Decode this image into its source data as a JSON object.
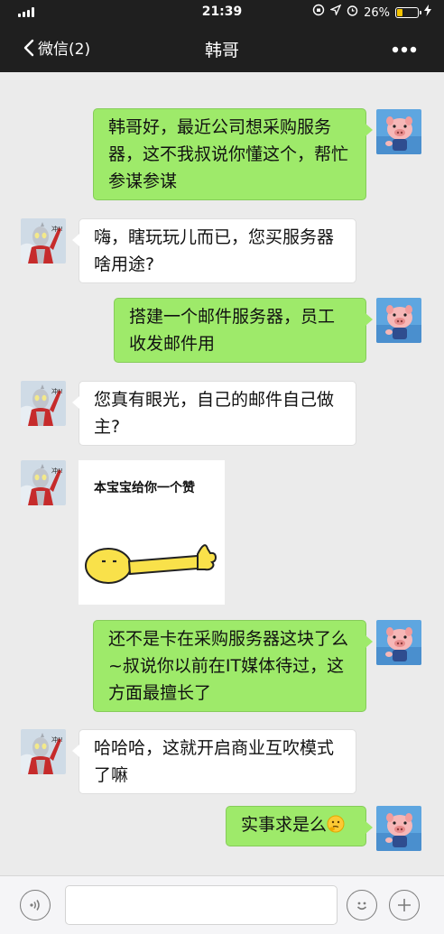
{
  "status_bar": {
    "time": "21:39",
    "battery_percent": "26%",
    "battery_level": 0.26,
    "battery_color": "#f5c400"
  },
  "nav": {
    "back_label": "微信(2)",
    "title": "韩哥",
    "more_icon": "more-dots-icon"
  },
  "messages": [
    {
      "side": "me",
      "text": "韩哥好，最近公司想采购服务器，这不我叔说你懂这个，帮忙参谋参谋"
    },
    {
      "side": "other",
      "text": "嗨，瞎玩玩儿而已，您买服务器啥用途?"
    },
    {
      "side": "me",
      "text": "搭建一个邮件服务器，员工收发邮件用"
    },
    {
      "side": "other",
      "text": "您真有眼光，自己的邮件自己做主?"
    },
    {
      "side": "other",
      "type": "sticker",
      "text": "本宝宝给你一个赞"
    },
    {
      "side": "me",
      "text": "还不是卡在采购服务器这块了么~叔说你以前在IT媒体待过，这方面最擅长了"
    },
    {
      "side": "other",
      "text": "哈哈哈，这就开启商业互吹模式了嘛"
    },
    {
      "side": "me",
      "text": "实事求是么",
      "emoji": "thinking-face-icon"
    }
  ],
  "input_bar": {
    "voice_icon": "voice-icon",
    "emoji_icon": "emoji-icon",
    "plus_icon": "plus-icon",
    "value": ""
  },
  "colors": {
    "my_bubble": "#9eea6a",
    "other_bubble": "#ffffff",
    "chat_background": "#ebebeb",
    "top_bar": "#1f1f1f"
  }
}
